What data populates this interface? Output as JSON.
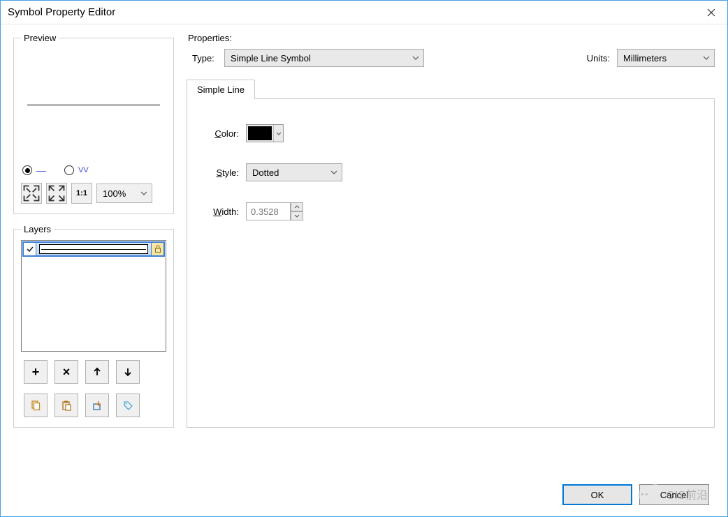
{
  "window": {
    "title": "Symbol Property Editor"
  },
  "preview": {
    "legend": "Preview",
    "zoom": "100%"
  },
  "layers": {
    "legend": "Layers"
  },
  "properties": {
    "heading": "Properties:",
    "type_label": "Type:",
    "type_value": "Simple Line Symbol",
    "units_label": "Units:",
    "units_value": "Millimeters",
    "tab": "Simple Line",
    "color_label": "Color:",
    "color_value": "#000000",
    "style_label": "Style:",
    "style_value": "Dotted",
    "width_label": "Width:",
    "width_value": "0.3528"
  },
  "buttons": {
    "ok": "OK",
    "cancel": "Cancel"
  },
  "watermark": "GIS前沿"
}
